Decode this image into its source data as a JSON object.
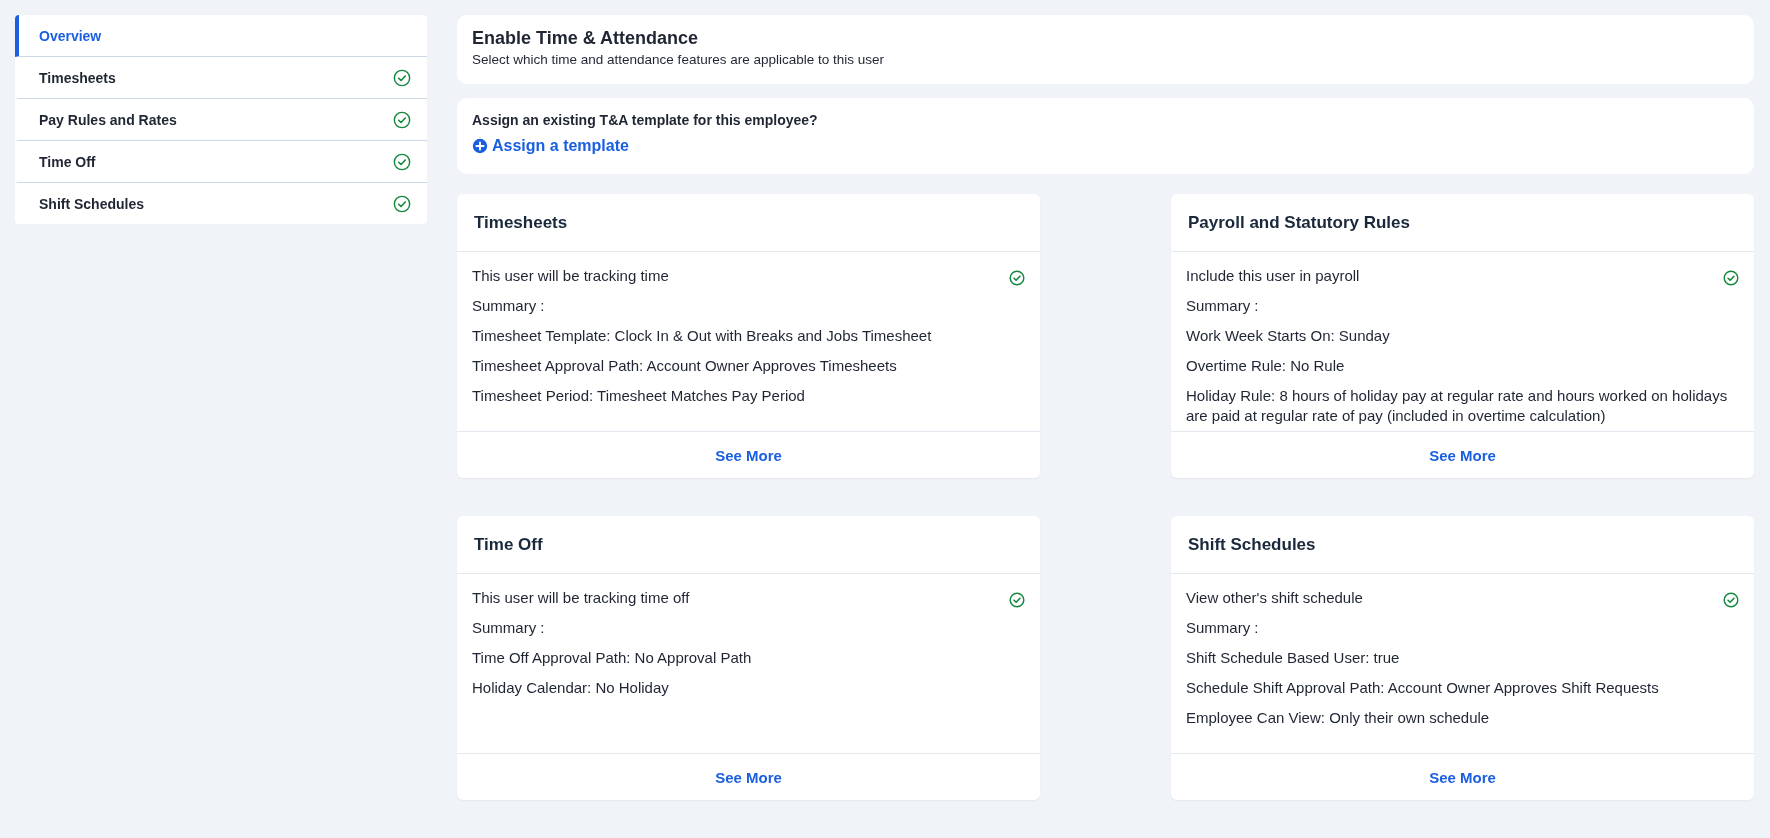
{
  "sidebar": {
    "items": [
      {
        "label": "Overview",
        "selected": true,
        "completed": false
      },
      {
        "label": "Timesheets",
        "selected": false,
        "completed": true
      },
      {
        "label": "Pay Rules and Rates",
        "selected": false,
        "completed": true
      },
      {
        "label": "Time Off",
        "selected": false,
        "completed": true
      },
      {
        "label": "Shift Schedules",
        "selected": false,
        "completed": true
      }
    ]
  },
  "header": {
    "title": "Enable Time & Attendance",
    "subtitle": "Select which time and attendance features are applicable to this user"
  },
  "template": {
    "question": "Assign an existing T&A template for this employee?",
    "link": "Assign a template"
  },
  "cards": [
    {
      "title": "Timesheets",
      "statement": "This user will be tracking time",
      "enabled": true,
      "summary_label": "Summary :",
      "lines": [
        "Timesheet Template: Clock In & Out with Breaks and Jobs Timesheet",
        "Timesheet Approval Path: Account Owner Approves Timesheets",
        "Timesheet Period: Timesheet Matches Pay Period"
      ],
      "action": "See More"
    },
    {
      "title": "Payroll and Statutory Rules",
      "statement": "Include this user in payroll",
      "enabled": true,
      "summary_label": "Summary :",
      "lines": [
        "Work Week Starts On: Sunday",
        "Overtime Rule: No Rule",
        "Holiday Rule: 8 hours of holiday pay at regular rate and hours worked on holidays are paid at regular rate of pay (included in overtime calculation)"
      ],
      "action": "See More"
    },
    {
      "title": "Time Off",
      "statement": "This user will be tracking time off",
      "enabled": true,
      "summary_label": "Summary :",
      "lines": [
        "Time Off Approval Path: No Approval Path",
        "Holiday Calendar: No Holiday"
      ],
      "action": "See More"
    },
    {
      "title": "Shift Schedules",
      "statement": "View other's shift schedule",
      "enabled": true,
      "summary_label": "Summary :",
      "lines": [
        "Shift Schedule Based User: true",
        "Schedule Shift Approval Path: Account Owner Approves Shift Requests",
        "Employee Can View: Only their own schedule"
      ],
      "action": "See More"
    }
  ]
}
